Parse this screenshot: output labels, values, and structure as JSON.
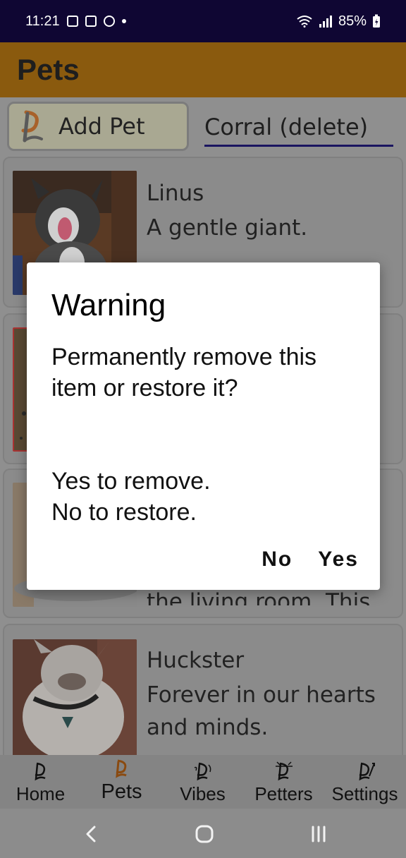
{
  "status_bar": {
    "time": "11:21",
    "battery": "85%"
  },
  "app_bar": {
    "title": "Pets"
  },
  "toolbar": {
    "add_pet_label": "Add Pet",
    "corral_value": "Corral (delete)"
  },
  "pets": [
    {
      "name": "Linus",
      "description": "A gentle giant."
    },
    {
      "name": "Huckster",
      "description": "Forever in our hearts and minds."
    }
  ],
  "partial_text": "the living room. This",
  "dialog": {
    "title": "Warning",
    "message_1": "Permanently remove this item or restore it?",
    "message_2": "Yes to remove.\nNo to restore.",
    "no_label": "No",
    "yes_label": "Yes"
  },
  "bottom_nav": {
    "items": [
      {
        "label": "Home",
        "icon": "home-icon"
      },
      {
        "label": "Pets",
        "icon": "pets-icon"
      },
      {
        "label": "Vibes",
        "icon": "vibes-icon"
      },
      {
        "label": "Petters",
        "icon": "petters-icon"
      },
      {
        "label": "Settings",
        "icon": "settings-icon"
      }
    ],
    "active_index": 1
  },
  "colors": {
    "status_bar": "#0f0633",
    "app_bar": "#8a5a0e",
    "accent_underline": "#1a1560",
    "scrim_bg": "#8f8f8f"
  }
}
